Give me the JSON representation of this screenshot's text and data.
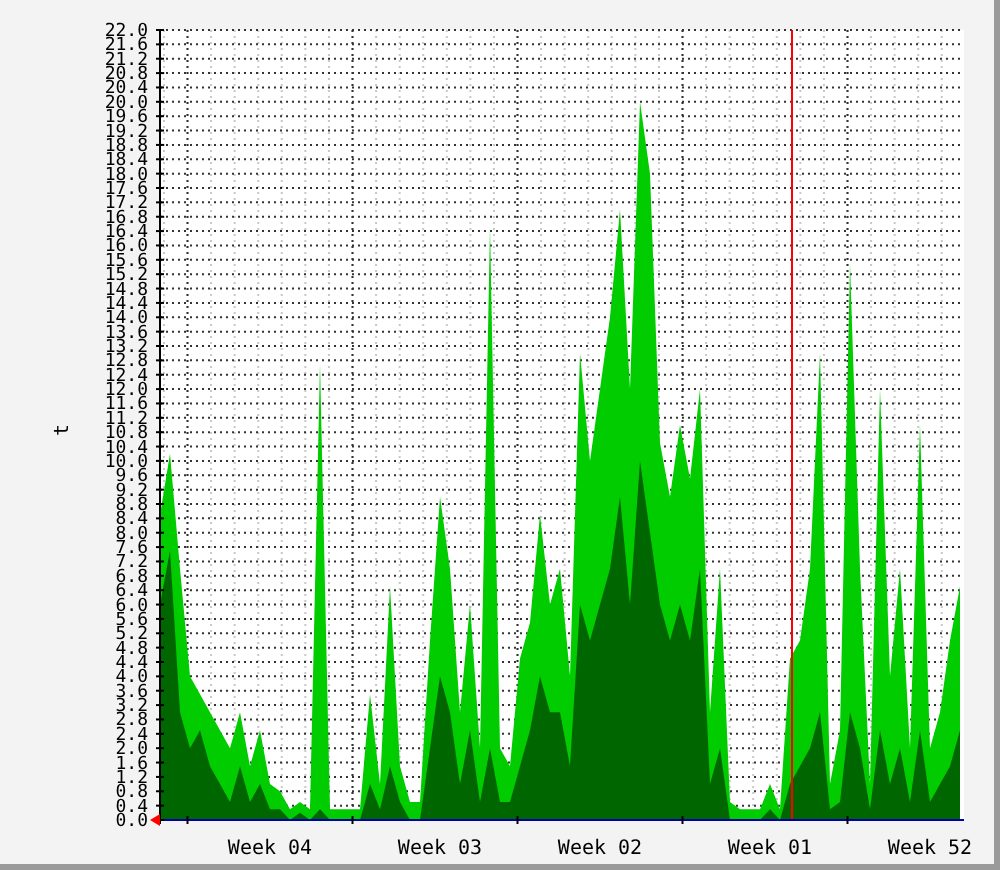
{
  "chart": {
    "chart_data": {
      "type": "area",
      "ylabel": "t",
      "categories": [
        null,
        null,
        null,
        null,
        null,
        null,
        null,
        null,
        null,
        null,
        null,
        "Week 04",
        null,
        null,
        null,
        null,
        null,
        null,
        null,
        null,
        null,
        null,
        null,
        null,
        null,
        null,
        null,
        null,
        "Week 03",
        null,
        null,
        null,
        null,
        null,
        null,
        null,
        null,
        null,
        null,
        null,
        null,
        null,
        null,
        null,
        "Week 02",
        null,
        null,
        null,
        null,
        null,
        null,
        null,
        null,
        null,
        null,
        null,
        null,
        null,
        null,
        null,
        null,
        "Week 01",
        null,
        null,
        null,
        null,
        null,
        null,
        null,
        null,
        null,
        null,
        null,
        null,
        null,
        null,
        null,
        "Week 52",
        null,
        null,
        null
      ],
      "ylim": [
        0,
        22
      ],
      "grid": true,
      "series": [
        {
          "color": "#00cc00",
          "values": [
            8.5,
            10.2,
            7,
            4,
            3.5,
            3,
            2.5,
            2,
            3,
            1.5,
            2.5,
            1,
            0.8,
            0.3,
            0.5,
            0.3,
            12.7,
            0.3,
            0.3,
            0.3,
            0.3,
            3.5,
            1,
            6.5,
            1.5,
            0.5,
            0.5,
            5,
            9,
            7,
            3,
            6,
            2,
            16.5,
            2,
            1.5,
            4.5,
            5.5,
            8.5,
            6,
            7,
            4,
            13,
            10,
            12,
            14,
            17,
            12,
            20,
            18,
            10.5,
            9,
            11,
            9.5,
            12,
            3,
            7,
            0.5,
            0.3,
            0.3,
            0.3,
            1,
            0.3,
            4.5,
            5,
            7,
            13,
            1,
            2.5,
            15.5,
            7,
            1,
            12,
            4,
            7,
            2,
            11,
            2,
            3,
            5,
            6.5
          ]
        },
        {
          "color": "#006600",
          "values": [
            6,
            7.5,
            3,
            2,
            2.5,
            1.5,
            1,
            0.5,
            1.5,
            0.5,
            1,
            0.3,
            0.3,
            0,
            0.2,
            0,
            0.3,
            0,
            0,
            0,
            0,
            1,
            0.3,
            1.5,
            0.5,
            0,
            0,
            2,
            4,
            3,
            1,
            2.5,
            0.5,
            2,
            0.5,
            0.5,
            1.5,
            2.5,
            4,
            3,
            3,
            1.5,
            6,
            5,
            6,
            7,
            9,
            6,
            10,
            8,
            6,
            5,
            6,
            5,
            7,
            1,
            2,
            0,
            0,
            0,
            0,
            0.3,
            0,
            1,
            1.5,
            2,
            3,
            0.3,
            0.5,
            3,
            2,
            0.3,
            2.5,
            1,
            2,
            0.5,
            2.5,
            0.5,
            1,
            1.5,
            2.5
          ]
        }
      ],
      "yticks": [
        {
          "value": 0,
          "label": "0.0"
        },
        {
          "value": 0.4,
          "label": "0.4"
        },
        {
          "value": 0.8,
          "label": "0.8"
        },
        {
          "value": 1.2,
          "label": "1.2"
        },
        {
          "value": 1.6,
          "label": "1.6"
        },
        {
          "value": 2,
          "label": "2.0"
        },
        {
          "value": 2.4,
          "label": "2.4"
        },
        {
          "value": 2.8,
          "label": "2.8"
        },
        {
          "value": 3.2,
          "label": "3.2"
        },
        {
          "value": 3.6,
          "label": "3.6"
        },
        {
          "value": 4,
          "label": "4.0"
        },
        {
          "value": 4.4,
          "label": "4.4"
        },
        {
          "value": 4.8,
          "label": "4.8"
        },
        {
          "value": 5.2,
          "label": "5.2"
        },
        {
          "value": 5.6,
          "label": "5.6"
        },
        {
          "value": 6,
          "label": "6.0"
        },
        {
          "value": 6.4,
          "label": "6.4"
        },
        {
          "value": 6.8,
          "label": "6.8"
        },
        {
          "value": 7.2,
          "label": "7.2"
        },
        {
          "value": 7.6,
          "label": "7.6"
        },
        {
          "value": 8,
          "label": "8.0"
        },
        {
          "value": 8.4,
          "label": "8.4"
        },
        {
          "value": 8.8,
          "label": "8.8"
        },
        {
          "value": 9.2,
          "label": "9.2"
        },
        {
          "value": 9.6,
          "label": "9.6"
        },
        {
          "value": 10,
          "label": "10.0"
        },
        {
          "value": 10.4,
          "label": "10.4"
        },
        {
          "value": 10.8,
          "label": "10.8"
        },
        {
          "value": 11.2,
          "label": "11.2"
        },
        {
          "value": 11.6,
          "label": "11.6"
        },
        {
          "value": 12,
          "label": "12.0"
        },
        {
          "value": 12.4,
          "label": "12.4"
        },
        {
          "value": 12.8,
          "label": "12.8"
        },
        {
          "value": 13.2,
          "label": "13.2"
        },
        {
          "value": 13.6,
          "label": "13.6"
        },
        {
          "value": 14,
          "label": "14.0"
        },
        {
          "value": 14.4,
          "label": "14.4"
        },
        {
          "value": 14.8,
          "label": "14.8"
        },
        {
          "value": 15.2,
          "label": "15.2"
        },
        {
          "value": 15.6,
          "label": "15.6"
        },
        {
          "value": 16,
          "label": "16.0"
        },
        {
          "value": 16.4,
          "label": "16.4"
        },
        {
          "value": 16.8,
          "label": "16.8"
        },
        {
          "value": 17.2,
          "label": "17.2"
        },
        {
          "value": 17.6,
          "label": "17.6"
        },
        {
          "value": 18,
          "label": "18.0"
        },
        {
          "value": 18.4,
          "label": "18.4"
        },
        {
          "value": 18.8,
          "label": "18.8"
        },
        {
          "value": 19.2,
          "label": "19.2"
        },
        {
          "value": 19.6,
          "label": "19.6"
        },
        {
          "value": 20,
          "label": "20.0"
        },
        {
          "value": 20.4,
          "label": "20.4"
        },
        {
          "value": 20.8,
          "label": "20.8"
        },
        {
          "value": 21.2,
          "label": "21.2"
        },
        {
          "value": 21.6,
          "label": "21.6"
        },
        {
          "value": 22,
          "label": "22.0"
        }
      ]
    }
  }
}
